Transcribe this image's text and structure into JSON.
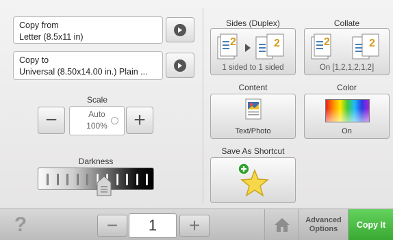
{
  "copy_from": {
    "label": "Copy from",
    "value": "Letter (8.5x11 in)"
  },
  "copy_to": {
    "label": "Copy to",
    "value": "Universal (8.50x14.00 in.) Plain ..."
  },
  "scale": {
    "label": "Scale",
    "mode": "Auto",
    "value": "100%",
    "minus": "−",
    "plus": "+"
  },
  "darkness": {
    "label": "Darkness",
    "level": 0.5
  },
  "sides": {
    "title": "Sides (Duplex)",
    "value": "1 sided to 1 sided"
  },
  "collate": {
    "title": "Collate",
    "value": "On [1,2,1,2,1,2]"
  },
  "content": {
    "title": "Content",
    "value": "Text/Photo"
  },
  "color": {
    "title": "Color",
    "value": "On"
  },
  "shortcut": {
    "title": "Save As Shortcut"
  },
  "bottom": {
    "help": "?",
    "quantity": "1",
    "minus": "−",
    "plus": "+",
    "advanced_line1": "Advanced",
    "advanced_line2": "Options",
    "copy": "Copy It"
  },
  "icons": [
    "arrow-right-icon",
    "duplex-icon",
    "collate-icon",
    "text-photo-icon",
    "color-gradient-icon",
    "star-plus-icon",
    "home-icon",
    "help-icon"
  ],
  "colors": {
    "copy_button": "#4cc046",
    "plus_badge": "#2fa12f",
    "star": "#f6d84a"
  }
}
